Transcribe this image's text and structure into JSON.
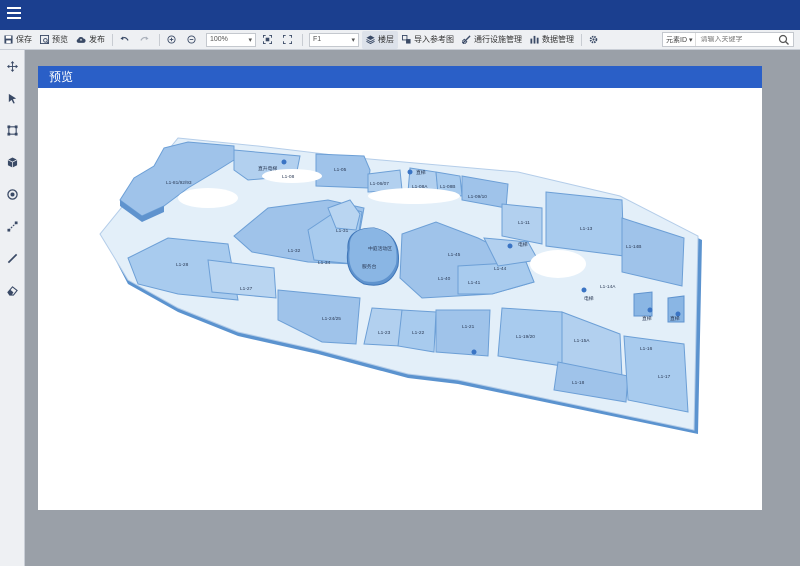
{
  "toolbar": {
    "save": "保存",
    "preview": "预览",
    "publish": "发布",
    "zoom": "100%",
    "floor": "F1",
    "layers": "楼层",
    "import_reference": "导入参考图",
    "passage_facility_management": "通行设施管理",
    "data_management": "数据管理",
    "search_type": "元素ID",
    "search_placeholder": "请输入关键字"
  },
  "dialog": {
    "title": "预览"
  },
  "map": {
    "labels": {
      "l1_81_92_93": "L1-81/92/93",
      "elevator_lift": "直升电梯",
      "l1_08": "L1-08",
      "l1_05": "L1-05",
      "l1_06_07": "L1-06/07",
      "stairs_1": "直梯",
      "l1_08a": "L1-08A",
      "l1_08b": "L1-08B",
      "l1_09_10": "L1-09/10",
      "escalator_1": "电梯",
      "l1_11": "L1-11",
      "l1_13": "L1-13",
      "l1_14b": "L1-14B",
      "l1_28": "L1-28",
      "l1_32": "L1-32",
      "l1_31": "L1-31",
      "central_atrium": "中庭活动区",
      "service_desk": "服务台",
      "l1_34": "L1-34",
      "l1_45": "L1-45",
      "escalator_2": "电梯",
      "l1_44": "L1-44",
      "l1_40": "L1-40",
      "l1_41": "L1-41",
      "l1_27": "L1-27",
      "l1_14a": "L1-14A",
      "escalator_3": "电梯",
      "l1_24_25": "L1-24/25",
      "l1_23": "L1-23",
      "l1_22": "L1-22",
      "l1_21": "L1-21",
      "l1_19_20": "L1-19/20",
      "l1_15a": "L1-15A",
      "l1_16": "L1-16",
      "stairs_2": "直梯",
      "stairs_3": "直梯",
      "l1_17": "L1-17",
      "l1_18": "L1-18"
    }
  }
}
